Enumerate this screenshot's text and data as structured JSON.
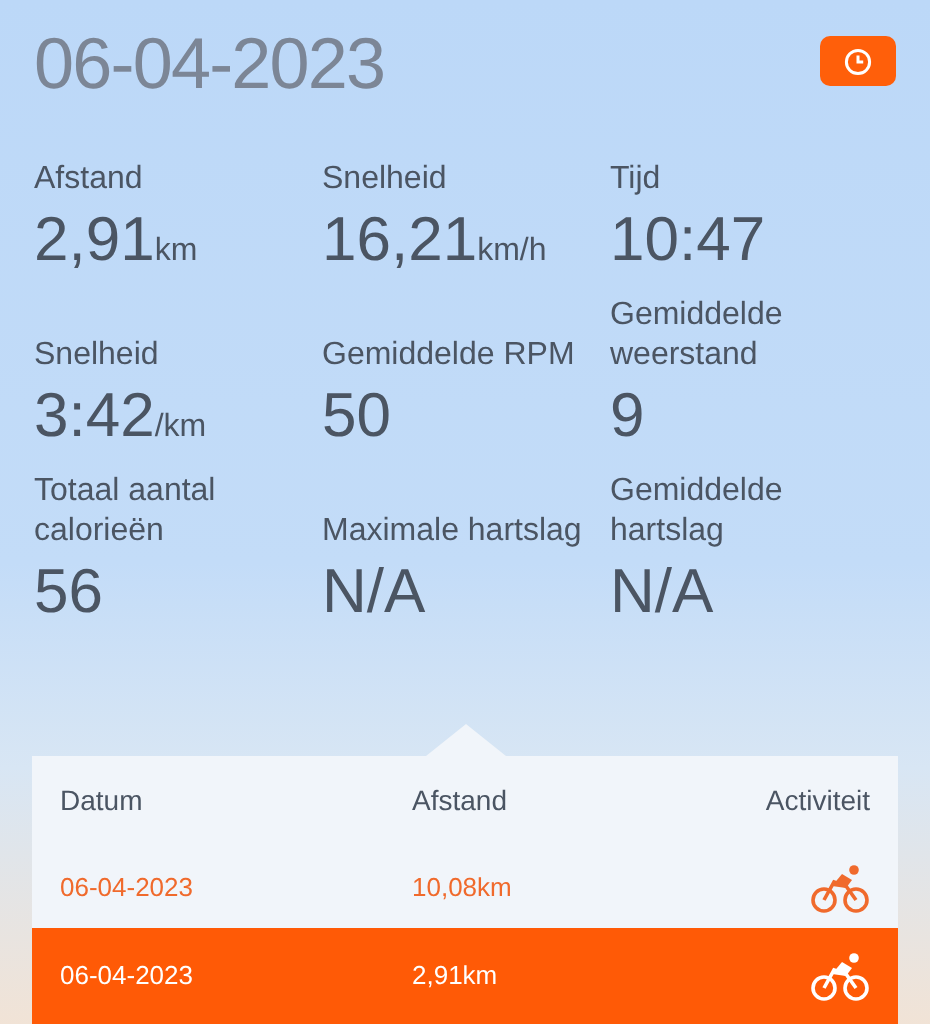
{
  "date": "06-04-2023",
  "stats": [
    [
      {
        "label": "Afstand",
        "value": "2,91",
        "unit": "km"
      },
      {
        "label": "Snelheid",
        "value": "16,21",
        "unit": "km/h"
      },
      {
        "label": "Tijd",
        "value": "10:47"
      }
    ],
    [
      {
        "label": "Snelheid",
        "value": "3:42",
        "unit": "/km"
      },
      {
        "label": "Gemiddelde RPM",
        "value": "50"
      },
      {
        "label": "Gemiddelde weerstand",
        "value": "9"
      }
    ],
    [
      {
        "label": "Totaal aantal calorieën",
        "value": "56"
      },
      {
        "label": "Maximale hartslag",
        "value": "N/A"
      },
      {
        "label": "Gemiddelde hartslag",
        "value": "N/A"
      }
    ]
  ],
  "table": {
    "columns": [
      "Datum",
      "Afstand",
      "Activiteit"
    ],
    "rows": [
      {
        "date": "06-04-2023",
        "distance": "10,08km",
        "selected": false
      },
      {
        "date": "06-04-2023",
        "distance": "2,91km",
        "selected": true
      }
    ]
  }
}
